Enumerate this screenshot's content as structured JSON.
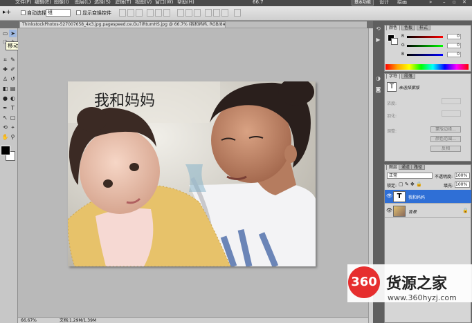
{
  "menubar": {
    "items": [
      "文件(F)",
      "编辑(E)",
      "图像(I)",
      "图层(L)",
      "选择(S)",
      "滤镜(T)",
      "视图(V)",
      "窗口(W)",
      "帮助(H)"
    ],
    "zoom": "66.7",
    "workspace_button": "基本功能",
    "design_label": "设计",
    "draw_label": "绘画"
  },
  "optbar": {
    "auto_select_label": "自动选择:",
    "auto_select_value": "组",
    "show_transform_label": "显示变换控件"
  },
  "tooltip": "移动工具 (V)",
  "document": {
    "tab_title": "ThinkstockPhotos-527007658_4x3.jpg.pagespeed.ce.Gu7iRtumHS.jpg @ 66.7% (我和妈妈, RGB/8#) *",
    "text_layer_content": "我和妈妈"
  },
  "statusbar": {
    "zoom": "66.67%",
    "doc_size": "文档:1.29M/1.39M"
  },
  "panels": {
    "color_tab": "颜色",
    "swatches_tab": "色板",
    "styles_tab": "样式",
    "r_label": "R",
    "g_label": "G",
    "b_label": "B",
    "r_value": "0",
    "g_value": "0",
    "b_value": "0",
    "char_tab": "字符",
    "para_tab": "段落",
    "char_preview": "未选择蒙版",
    "density_label": "浓度:",
    "feather_label": "羽化:",
    "refine_label": "调整:",
    "btn_mask_edge": "蒙版边缘...",
    "btn_color_range": "颜色范围...",
    "btn_invert": "反相",
    "layers_tab": "图层",
    "channels_tab": "通道",
    "paths_tab": "路径",
    "blend_mode": "正常",
    "opacity_label": "不透明度:",
    "opacity_value": "100%",
    "lock_label": "锁定:",
    "fill_label": "填充:",
    "fill_value": "100%",
    "layers": [
      {
        "name": "我和妈妈",
        "thumb": "T",
        "selected": true
      },
      {
        "name": "背景",
        "thumb": "",
        "selected": false
      }
    ]
  },
  "watermark": {
    "logo": "360",
    "title": "货源之家",
    "url": "www.360hyzj.com"
  }
}
